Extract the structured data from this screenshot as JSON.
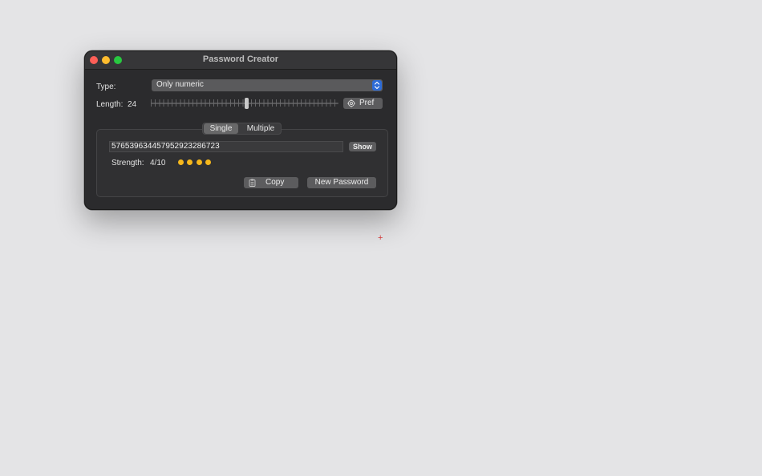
{
  "window": {
    "title": "Password Creator"
  },
  "type_row": {
    "label": "Type:",
    "selected_value": "Only numeric"
  },
  "length_row": {
    "label": "Length:",
    "value": "24",
    "slider_fraction": 0.51
  },
  "pref_button": {
    "label": "Pref",
    "icon": "gear-icon"
  },
  "tabs": {
    "items": [
      {
        "label": "Single",
        "selected": true
      },
      {
        "label": "Multiple",
        "selected": false
      }
    ]
  },
  "password": {
    "value": "576539634457952923286723",
    "show_label": "Show"
  },
  "strength": {
    "label": "Strength:",
    "value": "4/10",
    "filled_dots": 4,
    "dot_color": "#f6b81c"
  },
  "actions": {
    "copy_label": "Copy",
    "copy_icon": "clipboard-icon",
    "new_password_label": "New Password"
  },
  "colors": {
    "accent": "#2d6bd6",
    "close": "#fe5f57",
    "minimize": "#febc2e",
    "maximize": "#28c840",
    "cursor": "#d23a3a"
  }
}
